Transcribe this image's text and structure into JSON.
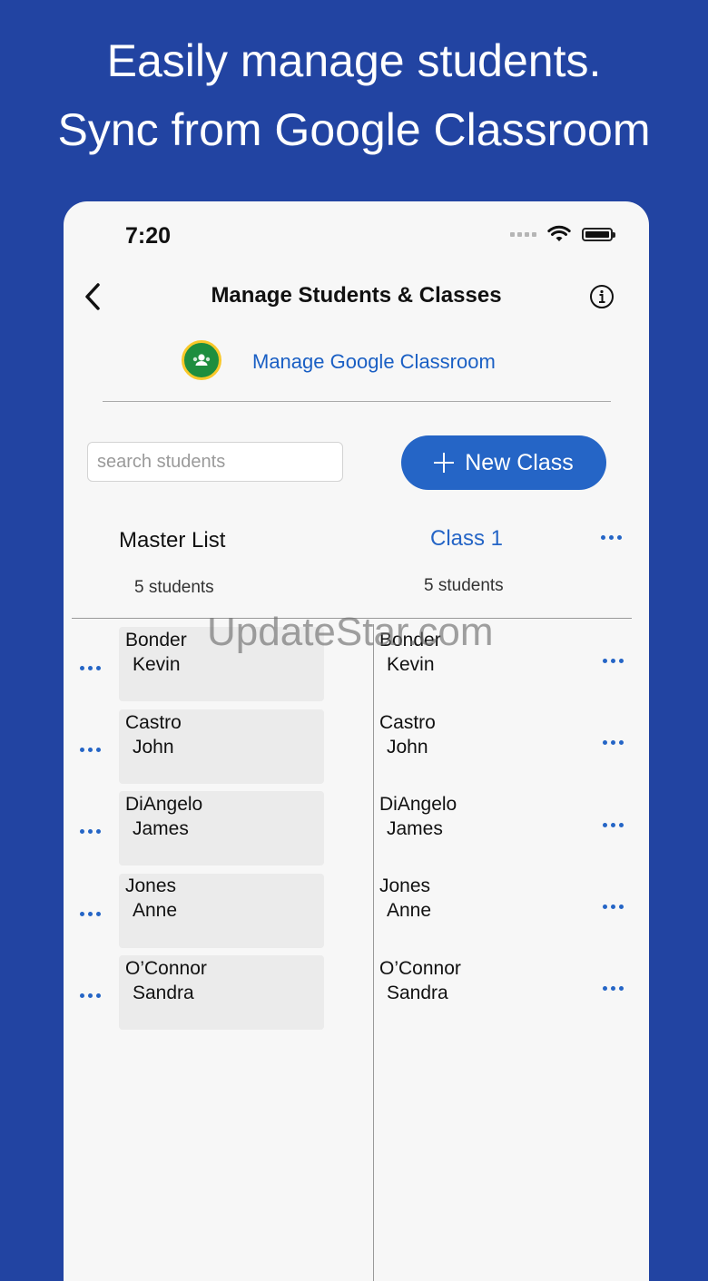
{
  "promo": {
    "line1": "Easily manage students.",
    "line2": "Sync from Google Classroom"
  },
  "status_bar": {
    "time": "7:20"
  },
  "nav": {
    "title": "Manage Students & Classes"
  },
  "google_classroom": {
    "link_label": "Manage Google Classroom"
  },
  "search": {
    "placeholder": "search students",
    "value": ""
  },
  "new_class_button": {
    "label": "New Class"
  },
  "master_list": {
    "title": "Master List",
    "count": "5 students",
    "students": [
      {
        "last": "Bonder",
        "first": "Kevin"
      },
      {
        "last": "Castro",
        "first": "John"
      },
      {
        "last": "DiAngelo",
        "first": "James"
      },
      {
        "last": "Jones",
        "first": "Anne"
      },
      {
        "last": "O’Connor",
        "first": "Sandra"
      }
    ]
  },
  "class_list": {
    "title": "Class 1",
    "count": "5 students",
    "students": [
      {
        "last": "Bonder",
        "first": "Kevin"
      },
      {
        "last": "Castro",
        "first": "John"
      },
      {
        "last": "DiAngelo",
        "first": "James"
      },
      {
        "last": "Jones",
        "first": "Anne"
      },
      {
        "last": "O’Connor",
        "first": "Sandra"
      }
    ]
  },
  "watermark": "UpdateStar.com",
  "colors": {
    "background": "#2244a2",
    "accent": "#2565c6",
    "link": "#1a5fc4"
  },
  "icons": [
    "back-chevron-icon",
    "info-icon",
    "google-classroom-icon",
    "plus-icon",
    "more-dots-icon",
    "wifi-icon",
    "battery-icon",
    "signal-icon"
  ]
}
